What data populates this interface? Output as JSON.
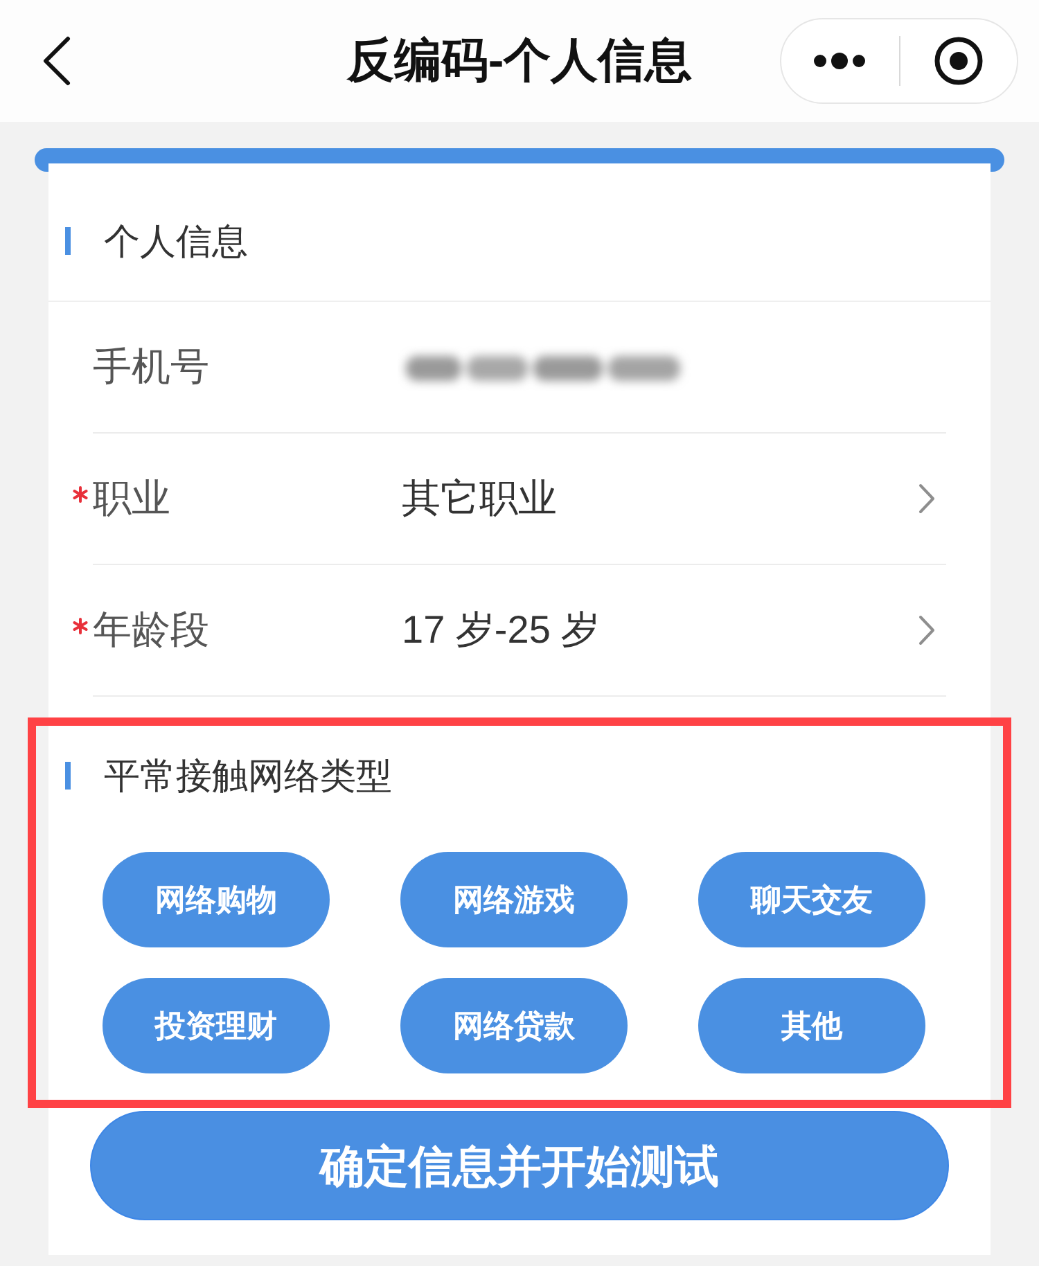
{
  "nav": {
    "title": "反编码-个人信息"
  },
  "personal_info": {
    "title": "个人信息",
    "fields": [
      {
        "label": "手机号",
        "kind": "redacted",
        "required": false
      },
      {
        "label": "职业",
        "kind": "select",
        "required": true,
        "value": "其它职业"
      },
      {
        "label": "年龄段",
        "kind": "select",
        "required": true,
        "value": "17 岁-25 岁"
      }
    ]
  },
  "network_types": {
    "title": "平常接触网络类型",
    "highlighted": true,
    "options": [
      {
        "label": "网络购物",
        "selected": false
      },
      {
        "label": "网络游戏",
        "selected": false
      },
      {
        "label": "聊天交友",
        "selected": false
      },
      {
        "label": "投资理财",
        "selected": false
      },
      {
        "label": "网络贷款",
        "selected": false
      },
      {
        "label": "其他",
        "selected": false
      }
    ]
  },
  "submit_button": {
    "label": "确定信息并开始测试"
  }
}
